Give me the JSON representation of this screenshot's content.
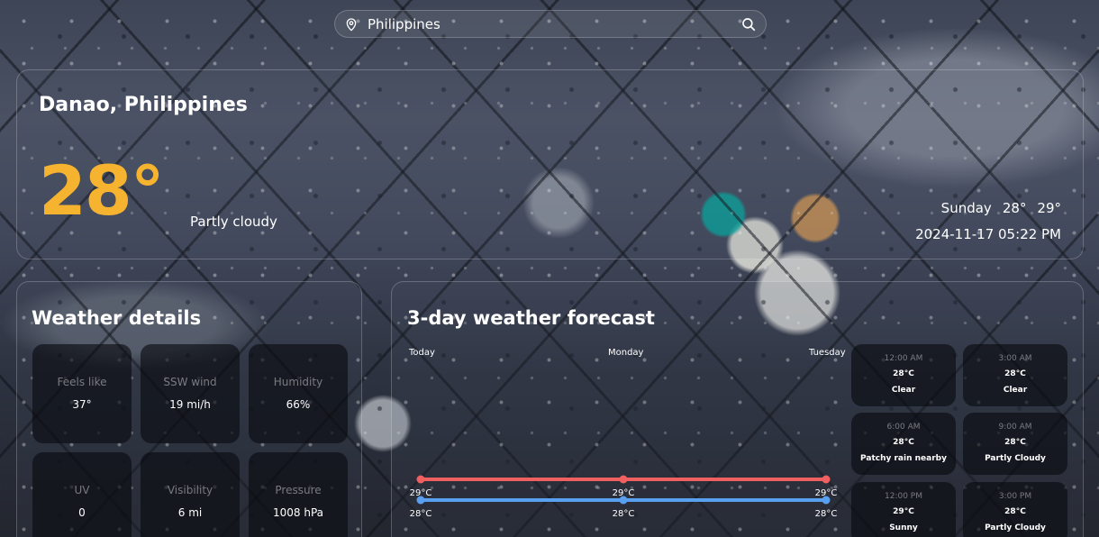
{
  "search": {
    "value": "Philippines"
  },
  "current": {
    "location": "Danao, Philippines",
    "temperature": "28°",
    "condition": "Partly cloudy",
    "day": "Sunday",
    "low": "28°",
    "high": "29°",
    "datetime": "2024-11-17 05:22 PM"
  },
  "details": {
    "title": "Weather details",
    "items": [
      {
        "label": "Feels like",
        "value": "37°"
      },
      {
        "label": "SSW wind",
        "value": "19 mi/h"
      },
      {
        "label": "Humidity",
        "value": "66%"
      },
      {
        "label": "UV",
        "value": "0"
      },
      {
        "label": "Visibility",
        "value": "6 mi"
      },
      {
        "label": "Pressure",
        "value": "1008 hPa"
      }
    ]
  },
  "forecast": {
    "title": "3-day weather forecast",
    "hourly": [
      {
        "time": "12:00 AM",
        "temp": "28°C",
        "desc": "Clear"
      },
      {
        "time": "3:00 AM",
        "temp": "28°C",
        "desc": "Clear"
      },
      {
        "time": "6:00 AM",
        "temp": "28°C",
        "desc": "Patchy rain nearby"
      },
      {
        "time": "9:00 AM",
        "temp": "28°C",
        "desc": "Partly Cloudy"
      },
      {
        "time": "12:00 PM",
        "temp": "29°C",
        "desc": "Sunny"
      },
      {
        "time": "3:00 PM",
        "temp": "28°C",
        "desc": "Partly Cloudy"
      }
    ]
  },
  "colors": {
    "accent": "#f5b330",
    "high_line": "#f06060",
    "low_line": "#5aa0f0"
  },
  "chart_data": {
    "type": "line",
    "categories": [
      "Today",
      "Monday",
      "Tuesday"
    ],
    "series": [
      {
        "values": [
          29,
          29,
          29
        ],
        "labels": [
          "29°C",
          "29°C",
          "29°C"
        ]
      },
      {
        "values": [
          28,
          28,
          28
        ],
        "labels": [
          "28°C",
          "28°C",
          "28°C"
        ]
      }
    ],
    "legend": "none",
    "grid": false
  }
}
